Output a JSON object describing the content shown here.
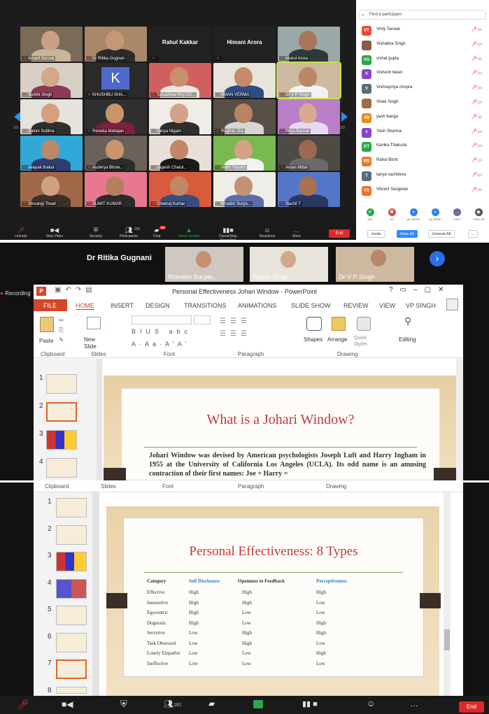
{
  "gallery": {
    "tiles": [
      {
        "name": "Amarit Bansal",
        "skin": "#c8a084",
        "bg": "#7a6a58",
        "shirt": "#c9b59b"
      },
      {
        "name": "Dr Ritika Gugnan",
        "skin": "#c59776",
        "bg": "#a88868",
        "shirt": "#2b2b2b"
      },
      {
        "name": "Rahul Kakkar",
        "big": true
      },
      {
        "name": "Himani Arora",
        "big": true
      },
      {
        "name": "Mukul Arora",
        "skin": "#a8765a",
        "bg": "#9aa8a8",
        "shirt": "#2d3a3a"
      },
      {
        "name": "Surbhi Singh",
        "skin": "#d2a88a",
        "bg": "#d8d0c4",
        "shirt": "#8a3a55"
      },
      {
        "name": "KHUSHBU SHA...",
        "letter": "K"
      },
      {
        "name": "Tanushree Roy Ch...",
        "skin": "#c8906c",
        "bg": "#d06060",
        "shirt": "#f0e8e0"
      },
      {
        "name": "AMAN VERMA",
        "skin": "#c48a6a",
        "bg": "#e8e4dc",
        "shirt": "#2e4d82"
      },
      {
        "name": "Dr V P Singh",
        "skin": "#b88868",
        "bg": "#cdb9a0",
        "shirt": "#f2f2f2",
        "hl": true
      },
      {
        "name": "Saloni Subhra",
        "skin": "#d4a07e",
        "bg": "#e6e2dc",
        "shirt": "#2f2f2f"
      },
      {
        "name": "Renuka Mahajan",
        "skin": "#c8946c",
        "bg": "#2f2f2f",
        "shirt": "#7a2240"
      },
      {
        "name": "Tanya Nigam",
        "skin": "#d4a288",
        "bg": "#f0ece8",
        "shirt": "#2e2e2e"
      },
      {
        "name": "Raghav Jha",
        "skin": "#b88464",
        "bg": "#585046",
        "shirt": "#d6d6d6"
      },
      {
        "name": "Priya Bansal",
        "skin": "#d8a890",
        "bg": "#b87ec8",
        "shirt": "#e8d8f0"
      },
      {
        "name": "deepak thakur",
        "skin": "#b88a68",
        "bg": "#32a8d8",
        "shirt": "#2e3e72"
      },
      {
        "name": "Auderya Bhow...",
        "skin": "#c8946e",
        "bg": "#6a625a",
        "shirt": "#2c2c2c"
      },
      {
        "name": "Jugesh Chatur...",
        "skin": "#c08868",
        "bg": "#e8e0d8",
        "shirt": "#1a1a1a"
      },
      {
        "name": "Nidhi Tripathi",
        "skin": "#d4a284",
        "bg": "#7ab850",
        "shirt": "#f2f2f2"
      },
      {
        "name": "Aman Mittal",
        "skin": "#9a6a4e",
        "bg": "#4e4a44",
        "shirt": "#6a6a6a"
      },
      {
        "name": "Shivangi Tiwari",
        "skin": "#d0a084",
        "bg": "#a06848",
        "shirt": "#3e2e2a"
      },
      {
        "name": "SUMIT KUMAR",
        "skin": "#b4805e",
        "bg": "#e87890",
        "shirt": "#2a2a2a"
      },
      {
        "name": "Dheeraj Kumar",
        "skin": "#c08866",
        "bg": "#d85c3c",
        "shirt": "#3a4c7a"
      },
      {
        "name": "Khadim Surya...",
        "skin": "#c49272",
        "bg": "#efede8",
        "shirt": "#5a6ea8"
      },
      {
        "name": "Sachit T",
        "skin": "#a67252",
        "bg": "#5476c8",
        "shirt": "#283860"
      }
    ],
    "page_left": "1/3",
    "page_right": "1/3"
  },
  "participants": {
    "search_placeholder": "Find a participant",
    "list": [
      {
        "initials": "VT",
        "name": "Vinty Tanwar",
        "color": "#e24d3d"
      },
      {
        "initials": "",
        "name": "Vishakha Singh",
        "color": "#8a5a4a",
        "photo": true
      },
      {
        "initials": "VG",
        "name": "vishal gupta",
        "color": "#2aa84a"
      },
      {
        "initials": "V",
        "name": "Vishesh tiwari",
        "color": "#8a44c8"
      },
      {
        "initials": "V",
        "name": "Vishnupriya chopra",
        "color": "#5a6a7a"
      },
      {
        "initials": "",
        "name": "Vivek Singh",
        "color": "#a06a44",
        "photo": true
      },
      {
        "initials": "YB",
        "name": "yash banga",
        "color": "#e88a1a"
      },
      {
        "initials": "Y",
        "name": "Yash Sharma",
        "color": "#8a44c8"
      },
      {
        "initials": "KT",
        "name": "Kanika Thakuria",
        "color": "#2aa84a"
      },
      {
        "initials": "RB",
        "name": "Rahul Bisht",
        "color": "#e87a2a"
      },
      {
        "initials": "T",
        "name": "tanya sachdeva",
        "color": "#5a6a7a"
      },
      {
        "initials": "VS",
        "name": "Vikrant Sangwan",
        "color": "#e8742a"
      }
    ],
    "reactions": [
      {
        "label": "yes",
        "color": "#2aa84a",
        "glyph": "✔"
      },
      {
        "label": "no",
        "color": "#e24d3d",
        "glyph": "✖"
      },
      {
        "label": "go slower",
        "color": "#2d7ee8",
        "glyph": "«"
      },
      {
        "label": "go faster",
        "color": "#2d7ee8",
        "glyph": "»"
      },
      {
        "label": "more",
        "color": "#6a6a9a",
        "glyph": "…"
      },
      {
        "label": "clear all",
        "color": "#555",
        "glyph": "◆"
      }
    ],
    "invite": "Invite",
    "mute_all": "Mute All",
    "unmute_all": "Unmute All",
    "more": "..."
  },
  "zoom_toolbar": {
    "items": [
      "Unmute",
      "Stop Video",
      "Security",
      "Participants",
      "Chat",
      "Share Screen",
      "Pause/Stop Recording",
      "Reactions",
      "More"
    ],
    "participant_count": "200",
    "chat_badge": "99",
    "end": "End"
  },
  "speaker_strip": {
    "main_name": "Dr Ritika Gugnani",
    "videos": [
      "Rhedem Suryav...",
      "Surbhi Singh",
      "Dr V P Singh"
    ],
    "recording": "Recording"
  },
  "ppt": {
    "title": "Personal Effectiveness Johari Window - PowerPoint",
    "user": "VP SINGH",
    "tabs": [
      "FILE",
      "HOME",
      "INSERT",
      "DESIGN",
      "TRANSITIONS",
      "ANIMATIONS",
      "SLIDE SHOW",
      "REVIEW",
      "VIEW"
    ],
    "groups": [
      "Clipboard",
      "Slides",
      "Font",
      "Paragraph",
      "Drawing"
    ],
    "buttons": {
      "paste": "Paste",
      "new_slide": "New Slide",
      "shapes": "Shapes",
      "arrange": "Arrange",
      "quick_styles": "Quick Styles",
      "editing": "Editing"
    },
    "slide_title": "What is a Johari Window?",
    "slide_body": "Johari Window was devised by American psychologists Joseph Luft and Harry Ingham in 1955 at the University of California Los Angeles (UCLA). Its odd name is an amusing contraction of their first names: Joe + Harry ="
  },
  "ppt2": {
    "groups": [
      "Clipboard",
      "Slides",
      "Font",
      "Paragraph",
      "Drawing"
    ],
    "slide_title": "Personal Effectiveness: 8 Types",
    "headers": [
      "Category",
      "Self Disclosure",
      "Openness to Feedback",
      "Perceptiveness"
    ],
    "rows": [
      [
        "Effective",
        "High",
        "High",
        "High"
      ],
      [
        "Insensitive",
        "High",
        "High",
        "Low"
      ],
      [
        "Egocentric",
        "High",
        "Low",
        "Low"
      ],
      [
        "Dogmatic",
        "High",
        "Low",
        "High"
      ],
      [
        "Secretive",
        "Low",
        "High",
        "High"
      ],
      [
        "Task Obsessed",
        "Low",
        "High",
        "Low"
      ],
      [
        "Lonely Empathic",
        "Low",
        "Low",
        "High"
      ],
      [
        "Ineffective",
        "Low",
        "Low",
        "Low"
      ]
    ],
    "thumb_numbers": [
      "1",
      "2",
      "3",
      "4",
      "5",
      "6",
      "7",
      "8"
    ],
    "participant_count": "181",
    "end": "End"
  }
}
